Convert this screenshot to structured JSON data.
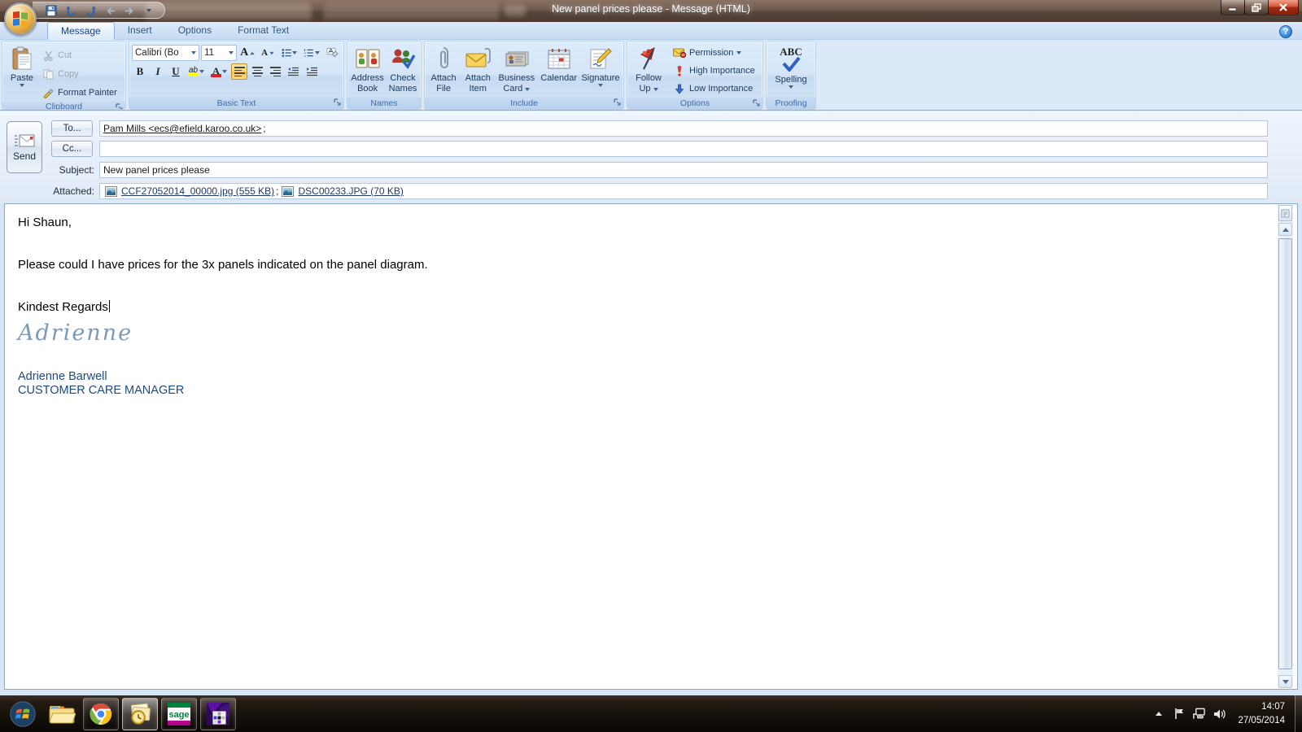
{
  "window": {
    "title": "New panel prices please - Message (HTML)"
  },
  "icons": {
    "help": "?"
  },
  "ribbon": {
    "tabs": [
      {
        "label": "Message"
      },
      {
        "label": "Insert"
      },
      {
        "label": "Options"
      },
      {
        "label": "Format Text"
      }
    ],
    "clipboard": {
      "label": "Clipboard",
      "paste": "Paste",
      "cut": "Cut",
      "copy": "Copy",
      "format_painter": "Format Painter"
    },
    "basic_text": {
      "label": "Basic Text",
      "font_name": "Calibri (Bo",
      "font_size": "11",
      "bold": "B",
      "italic": "I",
      "underline": "U",
      "grow_label": "A",
      "shrink_label": "A",
      "highlight_label": "ab",
      "font_color_label": "A"
    },
    "names": {
      "label": "Names",
      "address_book": "Address Book",
      "check_names": "Check Names"
    },
    "include": {
      "label": "Include",
      "attach_file": "Attach File",
      "attach_item": "Attach Item",
      "business_card": "Business Card",
      "calendar": "Calendar",
      "signature": "Signature"
    },
    "options": {
      "label": "Options",
      "follow_up": "Follow Up",
      "permission": "Permission",
      "high_importance": "High Importance",
      "low_importance": "Low Importance"
    },
    "proofing": {
      "label": "Proofing",
      "abc": "ABC",
      "spelling": "Spelling"
    }
  },
  "header": {
    "send": "Send",
    "to_button": "To...",
    "cc_button": "Cc...",
    "subject_label": "Subject:",
    "attached_label": "Attached:",
    "to_value": "Pam Mills <ecs@efield.karoo.co.uk>",
    "to_separator": ";",
    "cc_value": "",
    "subject_value": "New panel prices please",
    "attachments": [
      {
        "name": "CCF27052014_00000.jpg (555 KB)",
        "sep": ";"
      },
      {
        "name": "DSC00233.JPG (70 KB)",
        "sep": ""
      }
    ]
  },
  "body": {
    "greeting": "Hi Shaun,",
    "request": "Please could I have prices for the 3x panels indicated on the panel diagram.",
    "closing": "Kindest Regards",
    "signature_script": "Adrienne",
    "signature_name": "Adrienne Barwell",
    "signature_title": "CUSTOMER CARE MANAGER"
  },
  "taskbar": {
    "sage_label": "sage",
    "time": "14:07",
    "date": "27/05/2014"
  },
  "colors": {
    "selected_toggle_orange": "#ffd767",
    "signature_blue": "#1f497d",
    "script_blue": "#7b9ab7",
    "attachment_link_blue": "#1f3864",
    "close_button_red": "#a02a12"
  }
}
